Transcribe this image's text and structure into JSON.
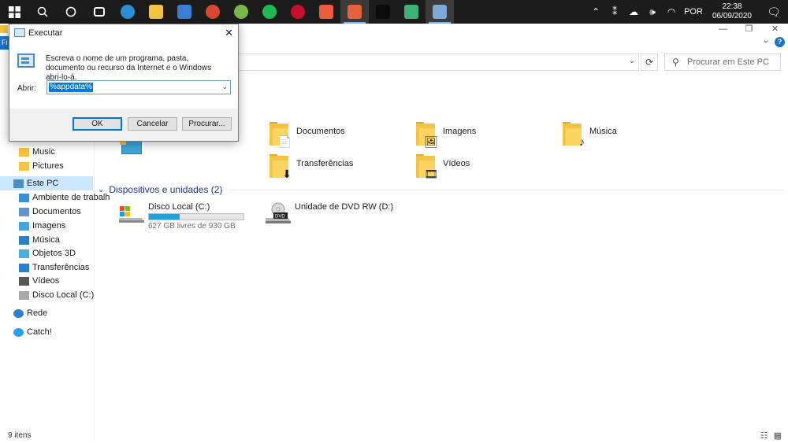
{
  "taskbar": {
    "apps": [
      {
        "name": "task-view-icon",
        "color": "#ffffff"
      },
      {
        "name": "edge-icon",
        "color": "#2b8fd6"
      },
      {
        "name": "file-explorer-icon",
        "color": "#f5c343"
      },
      {
        "name": "store-icon",
        "color": "#3b7fd4"
      },
      {
        "name": "chrome-icon",
        "color": "#d94735"
      },
      {
        "name": "green-app-icon",
        "color": "#7ab648"
      },
      {
        "name": "spotify-icon",
        "color": "#1db954"
      },
      {
        "name": "red-spider-icon",
        "color": "#c8102e"
      },
      {
        "name": "office-icon",
        "color": "#e95c3c"
      },
      {
        "name": "notification-app-icon",
        "color": "#e6623c"
      },
      {
        "name": "terminal-icon",
        "color": "#0c0c0c"
      },
      {
        "name": "download-app-icon",
        "color": "#3bb273"
      },
      {
        "name": "run-window-icon",
        "color": "#7fa8d6"
      }
    ],
    "language": "POR",
    "time": "22:38",
    "date": "06/09/2020"
  },
  "explorer": {
    "search_placeholder": "Procurar em Este PC",
    "folders": [
      {
        "label": "Documentos",
        "badge": "📄"
      },
      {
        "label": "Imagens",
        "badge": "🖼"
      },
      {
        "label": "Música",
        "badge": "♪"
      },
      {
        "label": "Transferências",
        "badge": "⬇"
      },
      {
        "label": "Vídeos",
        "badge": "🎞"
      }
    ],
    "drives_header": "Dispositivos e unidades (2)",
    "drives": [
      {
        "name": "Disco Local (C:)",
        "free": "627 GB livres de 930 GB",
        "used_fraction": 0.326
      },
      {
        "name": "Unidade de DVD RW (D:)"
      }
    ],
    "sidebar": [
      {
        "label": "Music",
        "icon": "folder"
      },
      {
        "label": "Pictures",
        "icon": "folder"
      },
      {
        "label": "Este PC",
        "icon": "pc"
      },
      {
        "label": "Ambiente de trabalh",
        "icon": "desktop"
      },
      {
        "label": "Documentos",
        "icon": "docs"
      },
      {
        "label": "Imagens",
        "icon": "images"
      },
      {
        "label": "Música",
        "icon": "music"
      },
      {
        "label": "Objetos 3D",
        "icon": "3d"
      },
      {
        "label": "Transferências",
        "icon": "download"
      },
      {
        "label": "Vídeos",
        "icon": "video"
      },
      {
        "label": "Disco Local (C:)",
        "icon": "drive"
      },
      {
        "label": "Rede",
        "icon": "network"
      },
      {
        "label": "Catch!",
        "icon": "catch"
      }
    ],
    "status": "9 itens",
    "titlebar_fragment": "Fi"
  },
  "run_dialog": {
    "title": "Executar",
    "description": "Escreva o nome de um programa, pasta, documento ou recurso da Internet e o Windows abri-lo-á.",
    "open_label": "Abrir:",
    "input_value": "%appdata%",
    "ok": "OK",
    "cancel": "Cancelar",
    "browse": "Procurar..."
  }
}
